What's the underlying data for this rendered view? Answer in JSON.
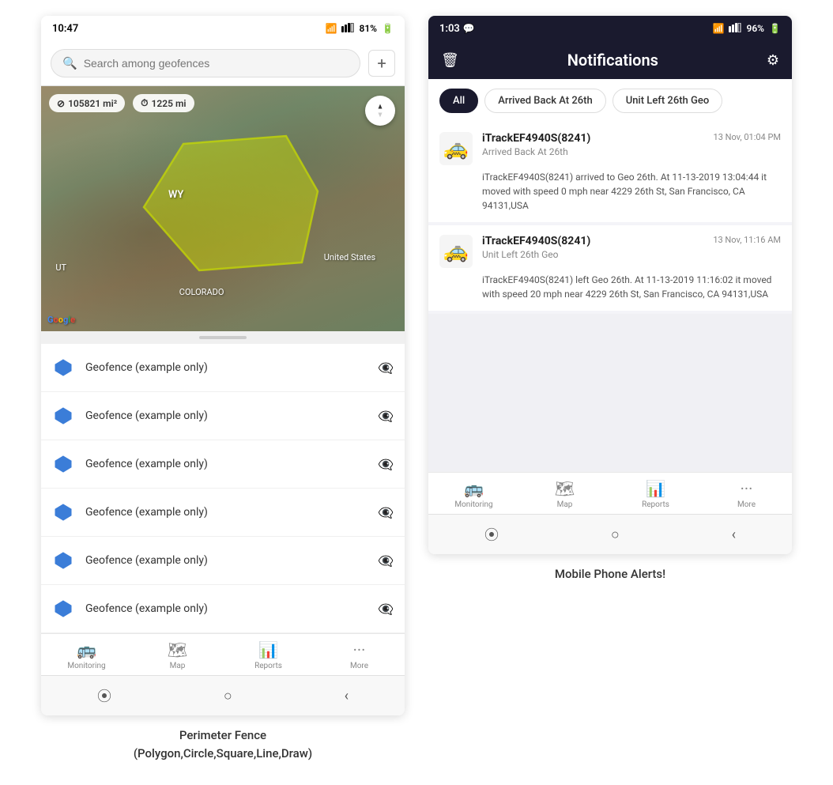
{
  "left_phone": {
    "status_bar": {
      "time": "10:47",
      "wifi": "WiFi",
      "signal": "4G",
      "battery": "81%"
    },
    "search": {
      "placeholder": "Search among geofences"
    },
    "map": {
      "stat1_icon": "⊘",
      "stat1_value": "105821 mi²",
      "stat2_icon": "⏱",
      "stat2_value": "1225 mi",
      "label_wy": "WY",
      "label_us": "United States",
      "label_colorado": "COLORADO",
      "label_ut": "UT"
    },
    "geofence_items": [
      {
        "name": "Geofence (example only)"
      },
      {
        "name": "Geofence (example only)"
      },
      {
        "name": "Geofence (example only)"
      },
      {
        "name": "Geofence (example only)"
      },
      {
        "name": "Geofence (example only)"
      },
      {
        "name": "Geofence (example only)"
      }
    ],
    "bottom_nav": [
      {
        "icon": "🚌",
        "label": "Monitoring"
      },
      {
        "icon": "🗺",
        "label": "Map"
      },
      {
        "icon": "📊",
        "label": "Reports"
      },
      {
        "icon": "•••",
        "label": "More"
      }
    ]
  },
  "right_phone": {
    "status_bar": {
      "time": "1:03",
      "chat_icon": "💬",
      "wifi": "WiFi",
      "signal": "4G",
      "battery": "96%"
    },
    "header": {
      "title": "Notifications",
      "delete_icon": "🗑",
      "settings_icon": "⚙"
    },
    "filter_tabs": [
      {
        "label": "All",
        "active": true
      },
      {
        "label": "Arrived Back At 26th",
        "active": false
      },
      {
        "label": "Unit Left 26th Geo",
        "active": false
      }
    ],
    "notifications": [
      {
        "vehicle": "iTrackEF4940S(8241)",
        "time": "13 Nov, 01:04 PM",
        "event_type": "Arrived Back At 26th",
        "description": "iTrackEF4940S(8241) arrived to Geo 26th.    At 11-13-2019 13:04:44 it moved with speed 0 mph near 4229 26th St, San Francisco, CA 94131,USA",
        "car_emoji": "🚕"
      },
      {
        "vehicle": "iTrackEF4940S(8241)",
        "time": "13 Nov, 11:16 AM",
        "event_type": "Unit Left 26th Geo",
        "description": "iTrackEF4940S(8241) left Geo 26th.    At 11-13-2019 11:16:02 it moved with speed 20 mph near 4229 26th St, San Francisco, CA 94131,USA",
        "car_emoji": "🚕"
      }
    ],
    "bottom_nav": [
      {
        "icon": "🚌",
        "label": "Monitoring"
      },
      {
        "icon": "🗺",
        "label": "Map"
      },
      {
        "icon": "📊",
        "label": "Reports"
      },
      {
        "icon": "•••",
        "label": "More"
      }
    ]
  },
  "captions": {
    "left": "Perimeter Fence\n(Polygon,Circle,Square,Line,Draw)",
    "right": "Mobile Phone Alerts!"
  }
}
